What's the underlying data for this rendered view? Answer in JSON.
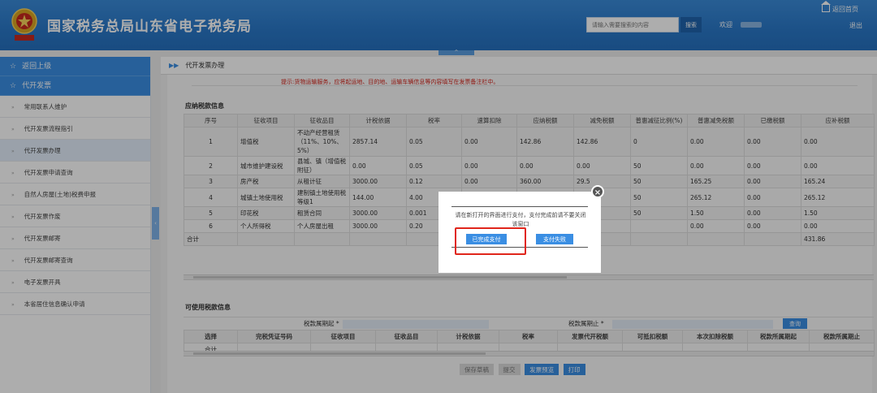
{
  "header": {
    "title": "国家税务总局山东省电子税务局",
    "search_placeholder": "请输入需要搜索的内容",
    "search_label": "搜索",
    "welcome": "欢迎",
    "home_label": "返回首页",
    "logout_label": "退出",
    "collapse_label": "^"
  },
  "sidebar": {
    "back_label": "返回上级",
    "section_label": "代开发票",
    "items": [
      {
        "label": "常用联系人维护"
      },
      {
        "label": "代开发票流程指引"
      },
      {
        "label": "代开发票办理"
      },
      {
        "label": "代开发票申请查询"
      },
      {
        "label": "自然人房屋(土地)税费申报"
      },
      {
        "label": "代开发票作废"
      },
      {
        "label": "代开发票邮寄"
      },
      {
        "label": "代开发票邮寄查询"
      },
      {
        "label": "电子发票开具"
      },
      {
        "label": "本省居住信息确认申请"
      }
    ],
    "active_index": 2,
    "toggle_label": "‹"
  },
  "main": {
    "tab_label": "代开发票办理",
    "notice": "提示:货物运输服务，应将起运地、目的地、运输车辆信息等内容填写在发票备注栏中。",
    "tax_section": {
      "title": "应纳税款信息",
      "headers": [
        "序号",
        "征收项目",
        "征收品目",
        "计税依据",
        "税率",
        "速算扣除",
        "应纳税额",
        "减免税额",
        "普惠减征比例(%)",
        "普惠减免税额",
        "已缴税额",
        "应补税额"
      ],
      "rows": [
        [
          "1",
          "增值税",
          "不动产经营租赁（11%、10%、5%）",
          "2857.14",
          "0.05",
          "0.00",
          "142.86",
          "142.86",
          "0",
          "0.00",
          "0.00",
          "0.00"
        ],
        [
          "2",
          "城市维护建设税",
          "县城、镇（增值税附征）",
          "0.00",
          "0.05",
          "0.00",
          "0.00",
          "0.00",
          "50",
          "0.00",
          "0.00",
          "0.00"
        ],
        [
          "3",
          "房产税",
          "从租计征",
          "3000.00",
          "0.12",
          "0.00",
          "360.00",
          "29.5",
          "50",
          "165.25",
          "0.00",
          "165.24"
        ],
        [
          "4",
          "城镇土地使用税",
          "建制镇土地使用税等级1",
          "144.00",
          "4.00",
          "",
          "",
          "",
          "50",
          "265.12",
          "0.00",
          "265.12"
        ],
        [
          "5",
          "印花税",
          "租赁合同",
          "3000.00",
          "0.001",
          "",
          "",
          "",
          "50",
          "1.50",
          "0.00",
          "1.50"
        ],
        [
          "6",
          "个人所得税",
          "个人房屋出租",
          "3000.00",
          "0.20",
          "",
          "",
          "",
          "",
          "0.00",
          "0.00",
          "0.00"
        ]
      ],
      "total_label": "合计",
      "total_value": "431.86"
    },
    "available_section": {
      "title": "可使用税款信息",
      "period_start_label": "税款属期起 *",
      "period_end_label": "税款属期止 *",
      "query_label": "查询",
      "headers": [
        "选择",
        "完税凭证号码",
        "征收项目",
        "征收品目",
        "计税依据",
        "税率",
        "发票代开税额",
        "可抵扣税额",
        "本次扣除税额",
        "税款所属期起",
        "税款所属期止"
      ],
      "total_label": "合计"
    },
    "buttons": {
      "save": "保存草稿",
      "submit": "提交",
      "invoice_preview": "发票预览",
      "print": "打印"
    }
  },
  "modal": {
    "message": "请在新打开的界面进行支付，支付完成前请不要关闭该窗口",
    "ok_label": "已完成支付",
    "fail_label": "支付失败",
    "close_label": "×"
  }
}
